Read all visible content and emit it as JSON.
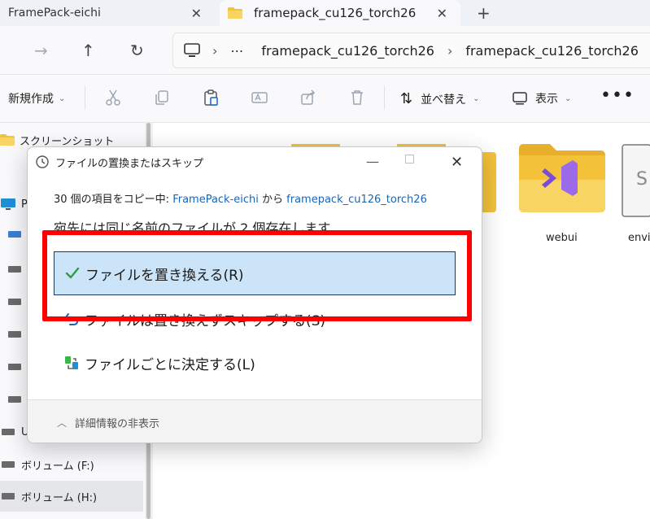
{
  "tabs": [
    {
      "label": "FramePack-eichi",
      "active": false
    },
    {
      "label": "framepack_cu126_torch26",
      "active": true
    }
  ],
  "address": {
    "ellipsis": "⋯",
    "crumbs": [
      "framepack_cu126_torch26",
      "framepack_cu126_torch26"
    ]
  },
  "toolbar": {
    "new_label": "新規作成",
    "sort_label": "並べ替え",
    "view_label": "表示",
    "more": "•••"
  },
  "sidebar": {
    "items": [
      {
        "label": "スクリーンショット"
      },
      {
        "label": "P"
      },
      {
        "label": "U"
      },
      {
        "label": "ボリューム (F:)"
      },
      {
        "label": "ボリューム (H:)"
      }
    ]
  },
  "content": {
    "files": [
      {
        "label": "webui"
      },
      {
        "label": "envi"
      }
    ]
  },
  "dialog": {
    "title": "ファイルの置換またはスキップ",
    "copy_prefix": "30 個の項目をコピー中: ",
    "copy_source": "FramePack-eichi",
    "copy_mid": " から ",
    "copy_dest": "framepack_cu126_torch26",
    "dest_message": "宛先には同じ名前のファイルが 2 個存在します",
    "option_replace": "ファイルを置き換える(R)",
    "option_skip": "ファイルは置き換えずスキップする(S)",
    "option_decide": "ファイルごとに決定する(L)",
    "footer": "詳細情報の非表示"
  },
  "colors": {
    "accent": "#1766b5",
    "highlight": "#cce4f7",
    "annotation": "#ff0000",
    "check": "#2e9e3e"
  }
}
